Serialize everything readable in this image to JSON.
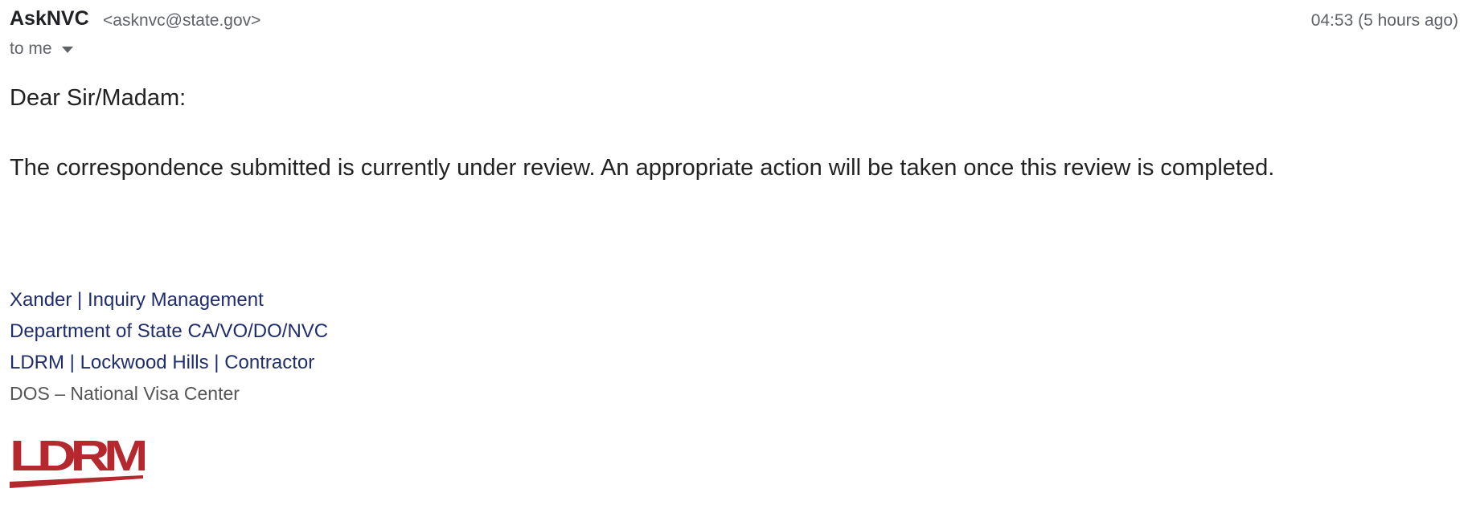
{
  "email": {
    "sender_name": "AskNVC",
    "sender_email": "<asknvc@state.gov>",
    "timestamp": "04:53 (5 hours ago)",
    "recipient": "to me",
    "greeting": "Dear Sir/Madam:",
    "message": "The correspondence submitted is currently under review. An appropriate action will be taken once this review is completed.",
    "signature": {
      "line1": "Xander | Inquiry Management",
      "line2": "Department of State CA/VO/DO/NVC",
      "line3": "LDRM | Lockwood Hills | Contractor",
      "line4": "DOS – National Visa Center"
    },
    "logo": {
      "text": "LDRM",
      "color": "#b5282e"
    }
  },
  "colors": {
    "signature_link": "#1f2d6e",
    "muted": "#5f6368",
    "body_text": "#222222"
  }
}
